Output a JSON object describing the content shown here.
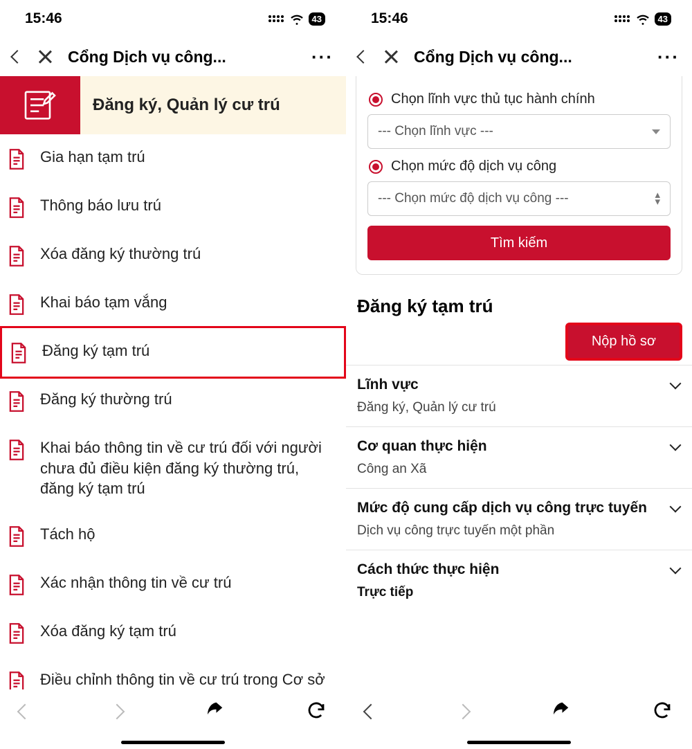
{
  "status": {
    "time": "15:46",
    "battery": "43"
  },
  "nav": {
    "title": "Cổng Dịch vụ công..."
  },
  "left": {
    "hero_title": "Đăng ký, Quản lý cư trú",
    "items": [
      {
        "label": "Gia hạn tạm trú",
        "highlight": false
      },
      {
        "label": "Thông báo lưu trú",
        "highlight": false
      },
      {
        "label": "Xóa đăng ký thường trú",
        "highlight": false
      },
      {
        "label": "Khai báo tạm vắng",
        "highlight": false
      },
      {
        "label": "Đăng ký tạm trú",
        "highlight": true
      },
      {
        "label": "Đăng ký thường trú",
        "highlight": false
      },
      {
        "label": "Khai báo thông tin về cư trú đối với người chưa đủ điều kiện đăng ký thường trú, đăng ký tạm trú",
        "highlight": false
      },
      {
        "label": "Tách hộ",
        "highlight": false
      },
      {
        "label": "Xác nhận thông tin về cư trú",
        "highlight": false
      },
      {
        "label": "Xóa đăng ký tạm trú",
        "highlight": false
      },
      {
        "label": "Điều chỉnh thông tin về cư trú trong Cơ sở dữ liệu về cư trú",
        "highlight": false
      }
    ]
  },
  "right": {
    "radio1_label": "Chọn lĩnh vực thủ tục hành chính",
    "select1_placeholder": "--- Chọn lĩnh vực ---",
    "radio2_label": "Chọn mức độ dịch vụ công",
    "select2_placeholder": "--- Chọn mức độ dịch vụ công ---",
    "search_label": "Tìm kiếm",
    "page_title": "Đăng ký tạm trú",
    "submit_label": "Nộp hồ sơ",
    "accordion": [
      {
        "title": "Lĩnh vực",
        "sub": "Đăng ký, Quản lý cư trú"
      },
      {
        "title": "Cơ quan thực hiện",
        "sub": "Công an Xã"
      },
      {
        "title": "Mức độ cung cấp dịch vụ công trực tuyến",
        "sub": "Dịch vụ công trực tuyến một phần"
      },
      {
        "title": "Cách thức thực hiện",
        "sub": "Trực tiếp"
      }
    ]
  }
}
